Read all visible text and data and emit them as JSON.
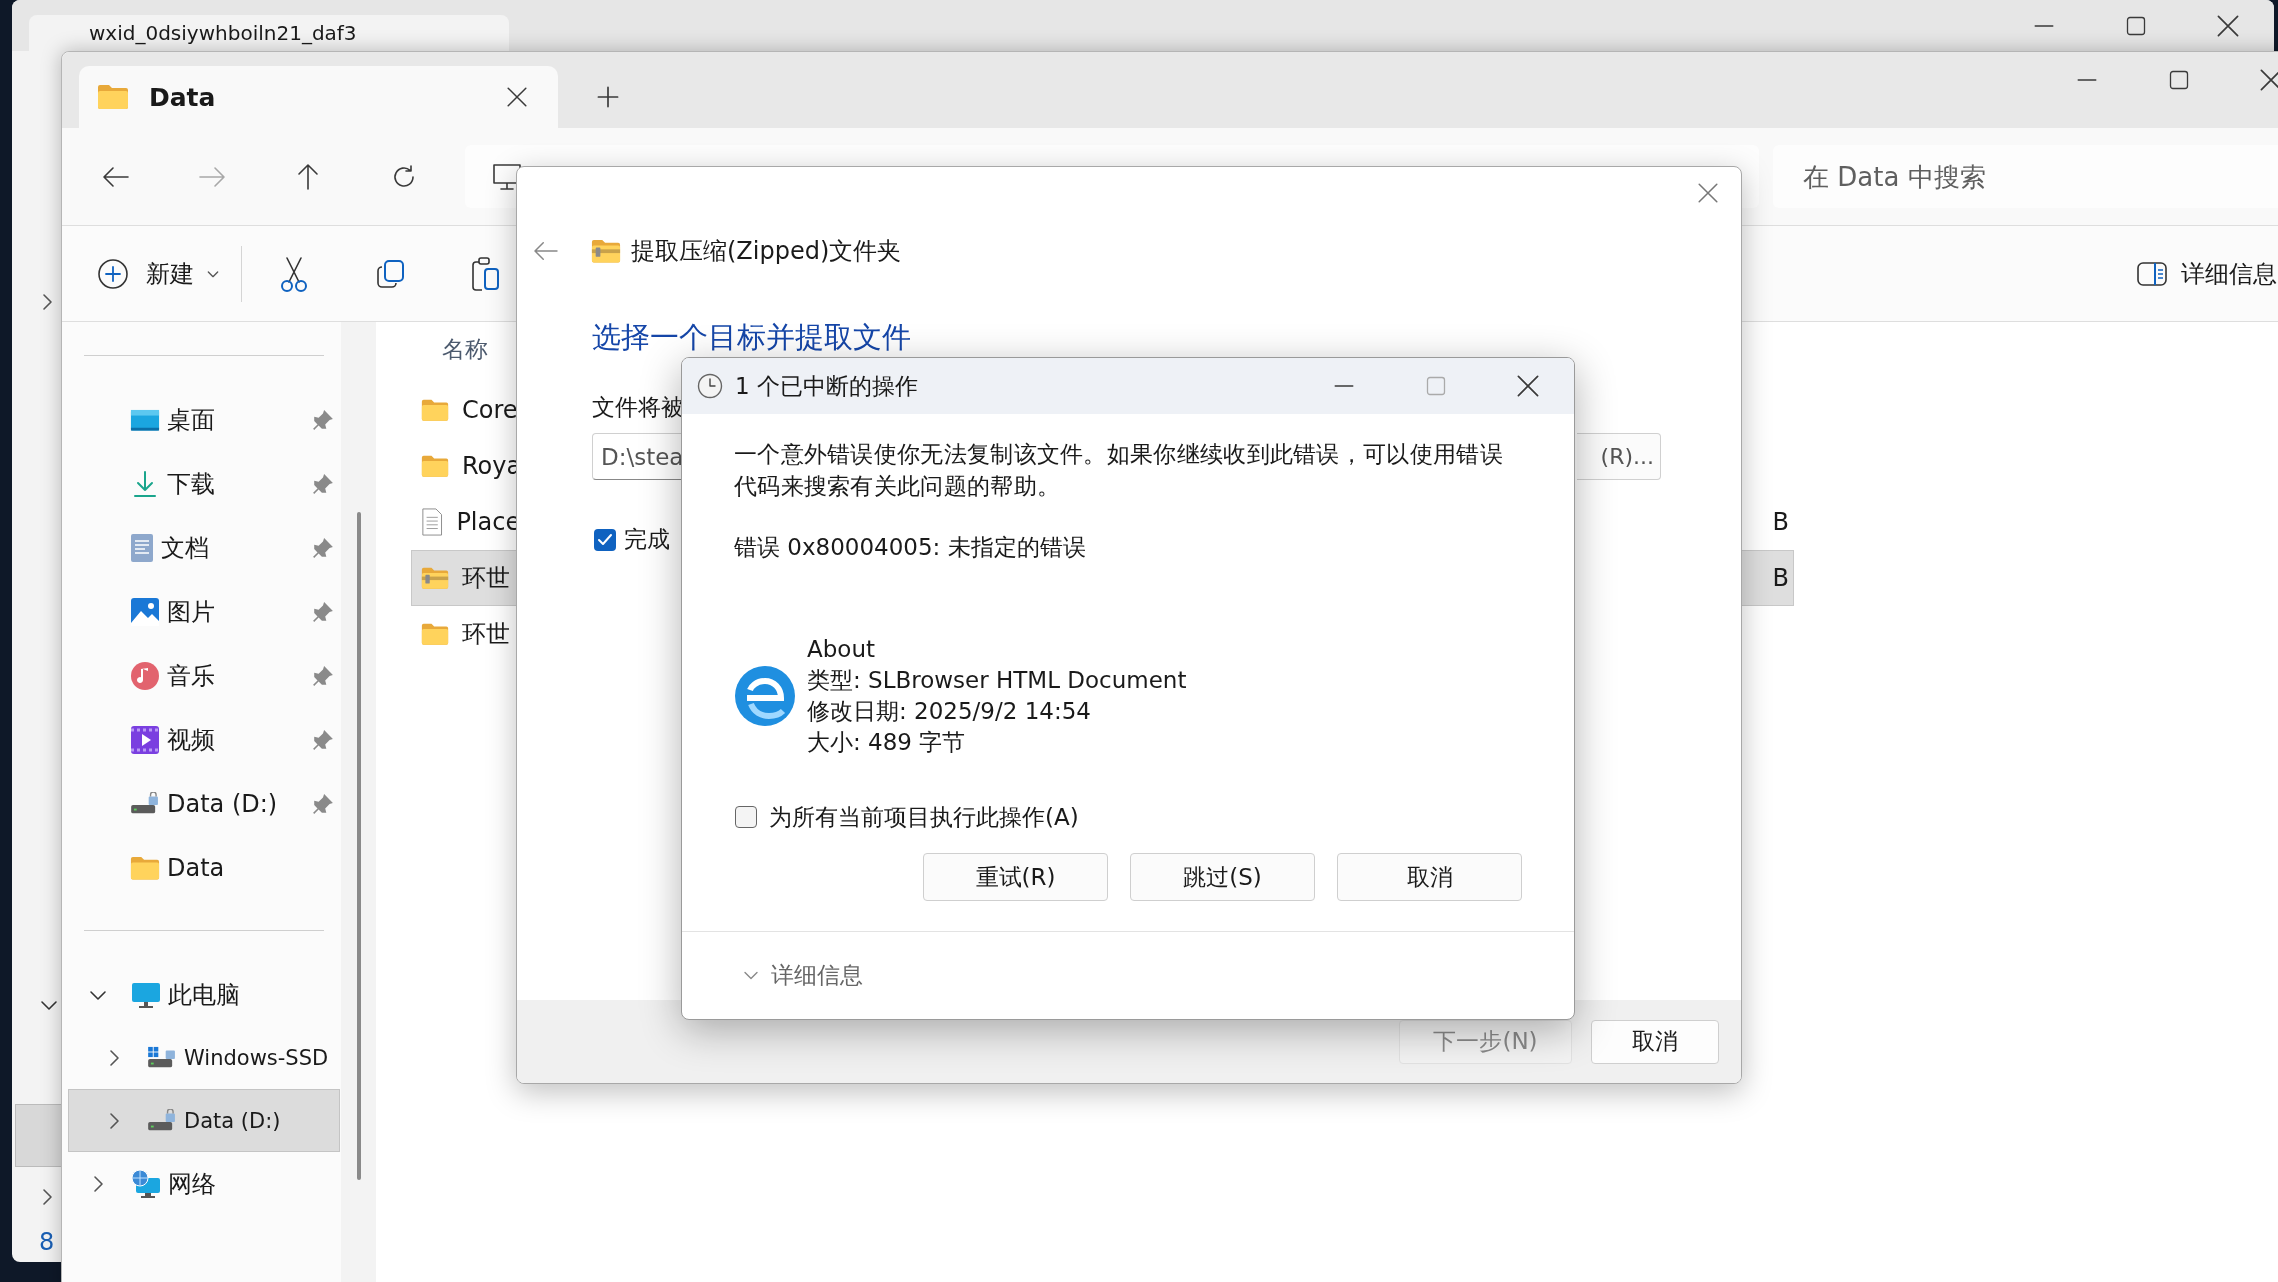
{
  "background_window": {
    "tab_title": "wxid_0dsiywhboiln21_daf3",
    "nav_fragment": "8"
  },
  "explorer": {
    "tab": {
      "title": "Data"
    },
    "search": {
      "placeholder": "在 Data 中搜索"
    },
    "commands": {
      "new": "新建",
      "details": "详细信息"
    },
    "quick_access": [
      {
        "label": "桌面",
        "kind": "desktop",
        "pinned": true
      },
      {
        "label": "下载",
        "kind": "downloads",
        "pinned": true
      },
      {
        "label": "文档",
        "kind": "documents",
        "pinned": true
      },
      {
        "label": "图片",
        "kind": "pictures",
        "pinned": true
      },
      {
        "label": "音乐",
        "kind": "music",
        "pinned": true
      },
      {
        "label": "视频",
        "kind": "videos",
        "pinned": true
      },
      {
        "label": "Data (D:)",
        "kind": "drive",
        "pinned": true
      },
      {
        "label": "Data",
        "kind": "folder",
        "pinned": false
      }
    ],
    "tree": [
      {
        "label": "此电脑",
        "kind": "pc",
        "expanded": true,
        "selected": false,
        "children": [
          {
            "label": "Windows-SSD",
            "kind": "system-drive",
            "expanded": false,
            "selected": false
          },
          {
            "label": "Data (D:)",
            "kind": "drive",
            "expanded": false,
            "selected": true
          }
        ]
      },
      {
        "label": "网络",
        "kind": "network",
        "expanded": false,
        "selected": false
      }
    ],
    "file_list": {
      "column": "名称",
      "rows": [
        {
          "name": "Core",
          "kind": "folder",
          "selected": false
        },
        {
          "name": "Roya",
          "kind": "folder",
          "selected": false
        },
        {
          "name": "Place",
          "kind": "file",
          "selected": false,
          "column_2": "B"
        },
        {
          "name": "环世",
          "kind": "zip",
          "selected": true,
          "column_2": "B"
        },
        {
          "name": "环世",
          "kind": "folder",
          "selected": false
        }
      ]
    }
  },
  "extract_wizard": {
    "title": "提取压缩(Zipped)文件夹",
    "heading": "选择一个目标并提取文件",
    "field_label": "文件将被",
    "path": "D:\\stea",
    "browse_button": "(R)...",
    "show_when_done": {
      "label": "完成",
      "checked": true
    },
    "buttons": [
      {
        "label": "下一步(N)",
        "disabled": true
      },
      {
        "label": "取消",
        "disabled": false
      }
    ]
  },
  "error_dialog": {
    "title": "1 个已中断的操作",
    "message": "一个意外错误使你无法复制该文件。如果你继续收到此错误，可以使用错误代码来搜索有关此问题的帮助。",
    "error": "错误 0x80004005: 未指定的错误",
    "file": {
      "name": "About",
      "type": "类型: SLBrowser HTML Document",
      "modified": "修改日期: 2025/9/2 14:54",
      "size": "大小: 489 字节"
    },
    "apply_to_all": {
      "label": "为所有当前项目执行此操作(A)",
      "checked": false
    },
    "buttons": [
      "重试(R)",
      "跳过(S)",
      "取消"
    ],
    "details": {
      "label": "详细信息",
      "expanded": false
    }
  }
}
